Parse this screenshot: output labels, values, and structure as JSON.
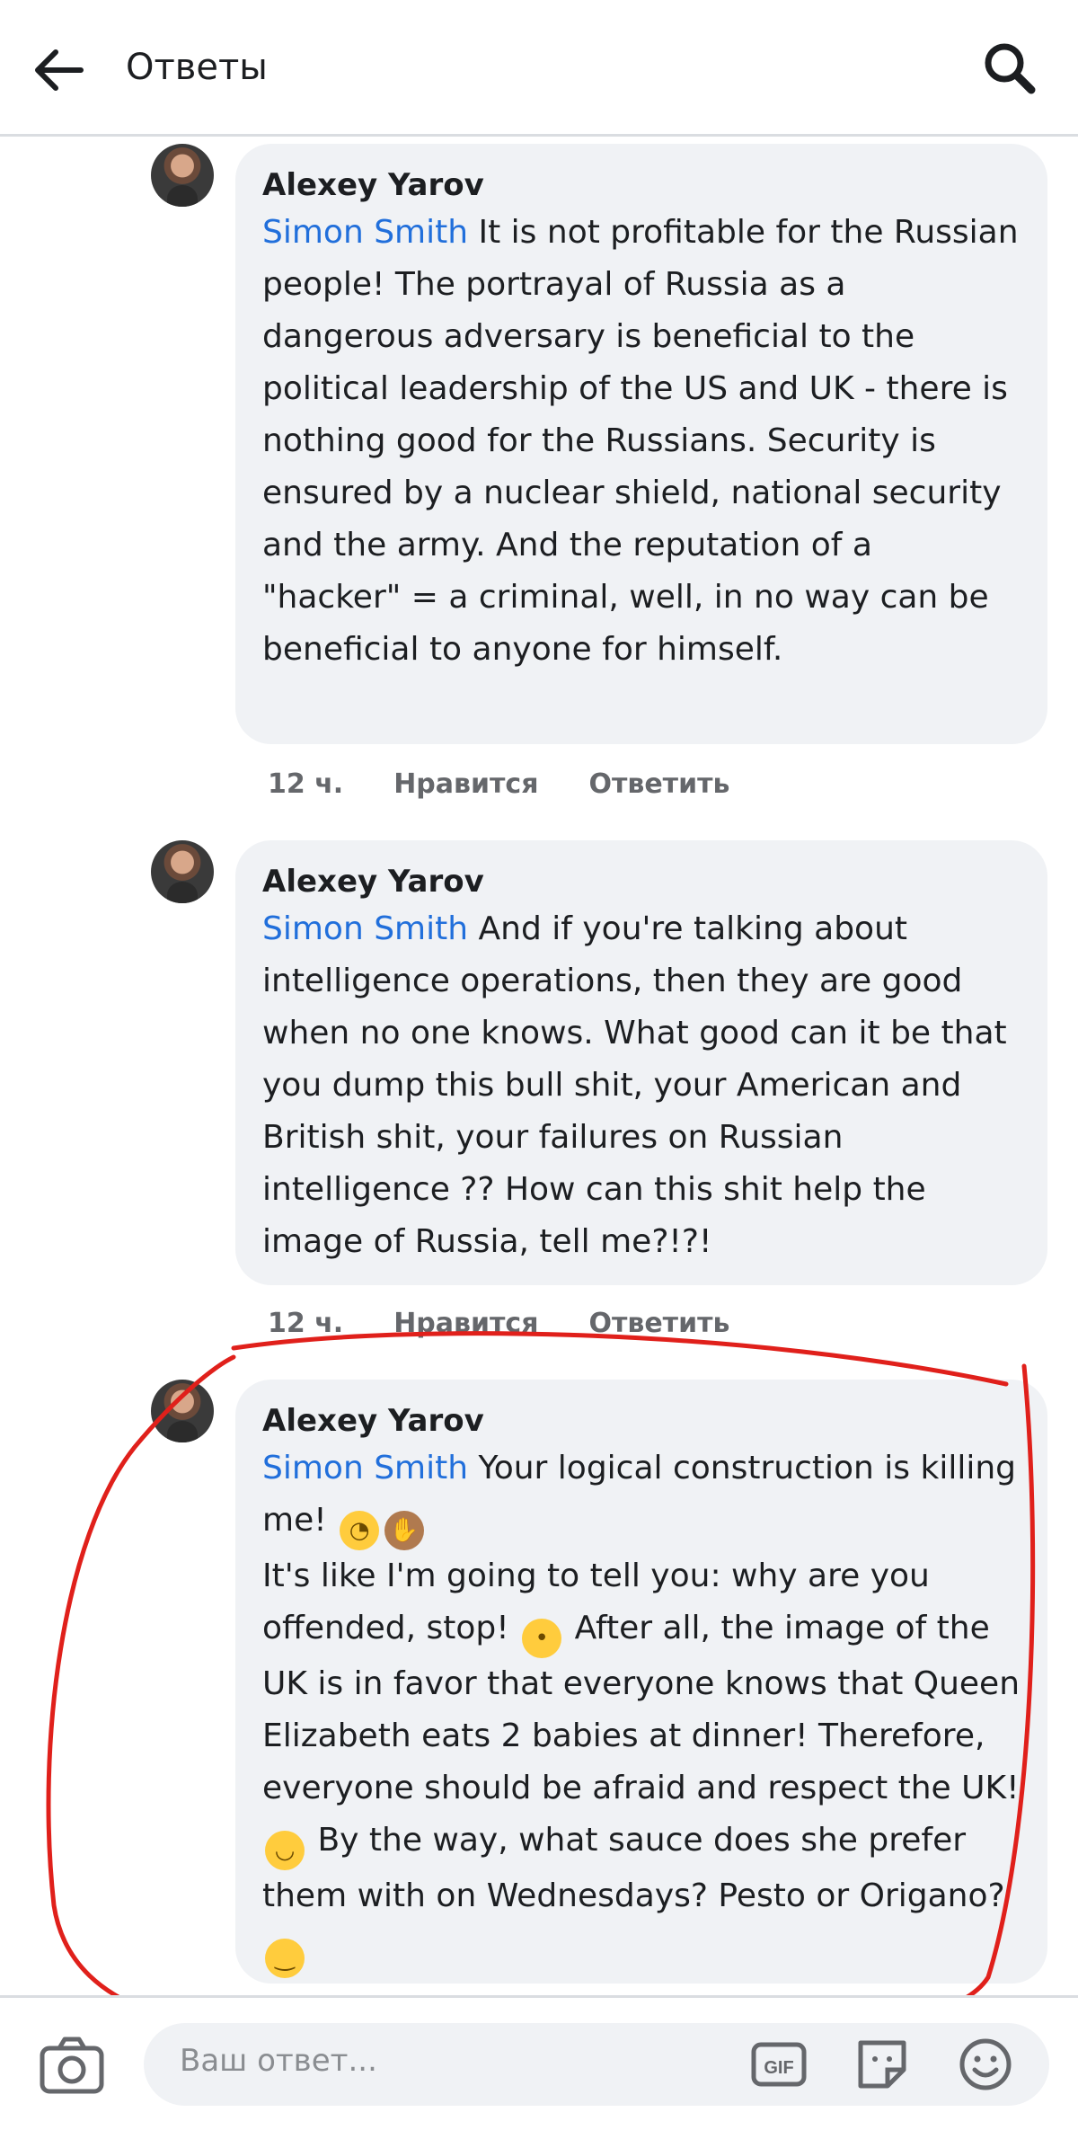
{
  "header": {
    "title": "Ответы",
    "back_icon": "arrow-left-icon",
    "search_icon": "search-icon"
  },
  "comments": [
    {
      "author": "Alexey Yarov",
      "mention": "Simon Smith",
      "text": " It is not profitable for the Russian people!  The portrayal of Russia as a dangerous adversary is beneficial to the political leadership of the US and UK - there is nothing good for the Russians. Security is ensured by a nuclear shield, national security and the army.  And the reputation of a \"hacker\" = a criminal, well, in no way can be beneficial to anyone for himself.",
      "time": "12 ч.",
      "like": "Нравится",
      "reply": "Ответить"
    },
    {
      "author": "Alexey Yarov",
      "mention": "Simon Smith",
      "text": " And if you're talking about intelligence operations, then they are good when no one knows.  What good can it be that you dump this bull shit, your American and British shit, your failures on Russian intelligence ??  How can this shit help the image of Russia, tell me?!?!",
      "time": "12 ч.",
      "like": "Нравится",
      "reply": "Ответить"
    },
    {
      "author": "Alexey Yarov",
      "mention": "Simon Smith",
      "text_1": " Your logical construction is killing me! ",
      "text_2": " It's like I'm going to tell you: why are you offended, stop! ",
      "text_3": " After all, the image of the UK is in favor that everyone knows that Queen Elizabeth eats 2 babies at dinner!  Therefore, everyone should be afraid and respect the UK! ",
      "text_4": " By the way, what sauce does she prefer them with on Wednesdays?  Pesto or Origano? "
    }
  ],
  "reply_bar": {
    "placeholder": "Ваш ответ...",
    "gif_label": "GIF"
  },
  "colors": {
    "mention": "#216fdb",
    "bubble": "#f0f2f5",
    "annotation": "#e0201b"
  }
}
